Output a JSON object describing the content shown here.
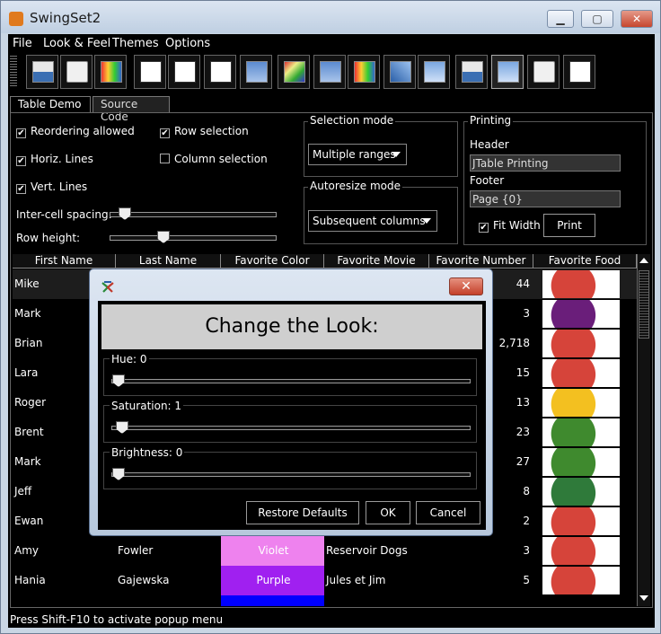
{
  "window": {
    "title": "SwingSet2",
    "minimize": "▁",
    "maximize": "▢",
    "close": "✕"
  },
  "menubar": [
    {
      "label": "File"
    },
    {
      "label": "Look & Feel"
    },
    {
      "label": "Themes"
    },
    {
      "label": "Options"
    }
  ],
  "tabs": {
    "table_demo": "Table Demo",
    "source_code": "Source Code"
  },
  "options": {
    "reordering": "Reordering allowed",
    "row_selection": "Row selection",
    "horiz_lines": "Horiz. Lines",
    "column_selection": "Column selection",
    "vert_lines": "Vert. Lines",
    "intercell_spacing": "Inter-cell spacing:",
    "row_height": "Row height:",
    "intercell_value": 0.05,
    "row_height_value": 0.3
  },
  "selection_mode": {
    "legend": "Selection mode",
    "value": "Multiple ranges"
  },
  "autoresize_mode": {
    "legend": "Autoresize mode",
    "value": "Subsequent columns"
  },
  "printing": {
    "legend": "Printing",
    "header_label": "Header",
    "header_value": "JTable Printing",
    "footer_label": "Footer",
    "footer_value": "Page {0}",
    "fit_width": "Fit Width",
    "print_button": "Print"
  },
  "table": {
    "columns": [
      "First Name",
      "Last Name",
      "Favorite Color",
      "Favorite Movie",
      "Favorite Number",
      "Favorite Food"
    ],
    "rows": [
      {
        "first": "Mike",
        "last": "",
        "color": "",
        "movie": "",
        "number": "44",
        "color_hex": ""
      },
      {
        "first": "Mark",
        "last": "",
        "color": "",
        "movie": "",
        "number": "3",
        "color_hex": ""
      },
      {
        "first": "Brian",
        "last": "",
        "color": "",
        "movie": "",
        "number": "2,718",
        "color_hex": ""
      },
      {
        "first": "Lara",
        "last": "",
        "color": "",
        "movie": "",
        "number": "15",
        "color_hex": ""
      },
      {
        "first": "Roger",
        "last": "",
        "color": "",
        "movie": "",
        "number": "13",
        "color_hex": ""
      },
      {
        "first": "Brent",
        "last": "",
        "color": "",
        "movie": "",
        "number": "23",
        "color_hex": ""
      },
      {
        "first": "Mark",
        "last": "",
        "color": "",
        "movie": "",
        "number": "27",
        "color_hex": ""
      },
      {
        "first": "Jeff",
        "last": "",
        "color": "",
        "movie": "",
        "number": "8",
        "color_hex": ""
      },
      {
        "first": "Ewan",
        "last": "",
        "color": "",
        "movie": "",
        "number": "2",
        "color_hex": ""
      },
      {
        "first": "Amy",
        "last": "Fowler",
        "color": "Violet",
        "movie": "Reservoir Dogs",
        "number": "3",
        "color_hex": "#ee82ee"
      },
      {
        "first": "Hania",
        "last": "Gajewska",
        "color": "Purple",
        "movie": "Jules et Jim",
        "number": "5",
        "color_hex": "#a020f0"
      }
    ]
  },
  "status": "Press Shift-F10 to activate popup menu",
  "dialog": {
    "title_icon": "swing-logo-icon",
    "close": "✕",
    "header": "Change the Look:",
    "hue_label": "Hue: 0",
    "saturation_label": "Saturation: 1",
    "brightness_label": "Brightness: 0",
    "hue_value": 0,
    "saturation_value": 1,
    "brightness_value": 0,
    "restore": "Restore Defaults",
    "ok": "OK",
    "cancel": "Cancel"
  },
  "colors": {
    "selected_row": "#1d1d1d",
    "violet": "#ee82ee",
    "purple": "#a020f0",
    "blue": "#0000ff"
  }
}
